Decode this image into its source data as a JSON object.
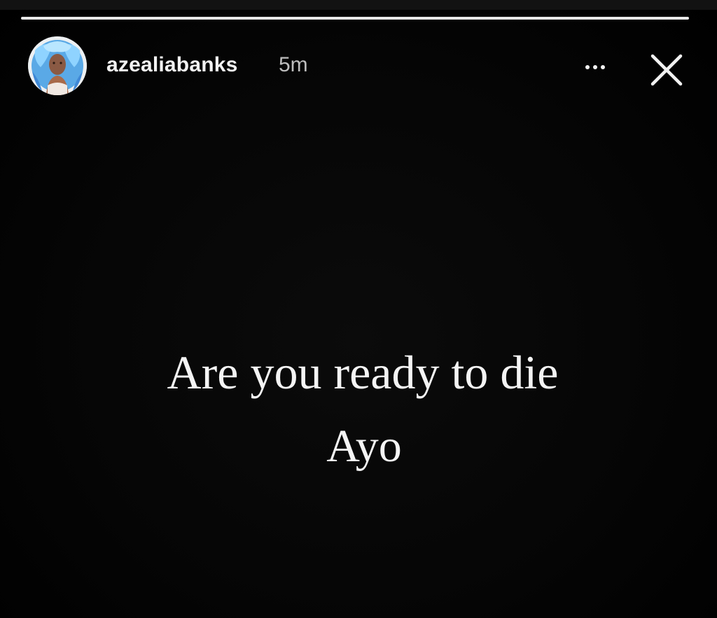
{
  "story": {
    "progress": [
      {
        "fraction": 1.0
      }
    ]
  },
  "header": {
    "username": "azealiabanks",
    "timestamp": "5m",
    "avatar_icon": "profile-avatar",
    "more_icon": "more-horizontal-icon",
    "close_icon": "close-icon"
  },
  "content": {
    "line1": "Are you ready to die",
    "line2": "Ayo"
  },
  "colors": {
    "background": "#000000",
    "text": "#f4f4f4",
    "muted_text": "#bdbdbd"
  }
}
